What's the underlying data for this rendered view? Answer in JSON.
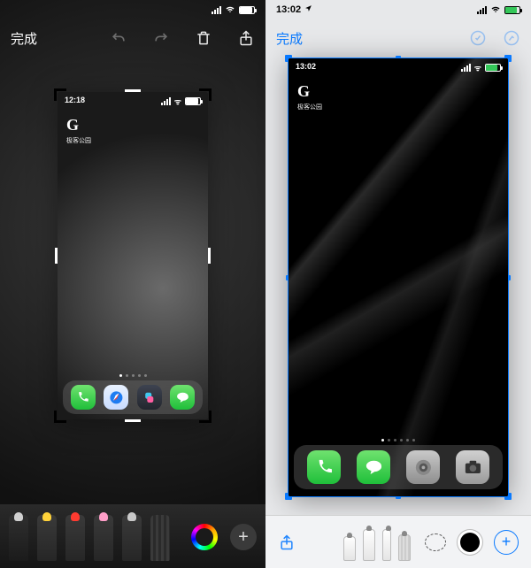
{
  "left": {
    "nav": {
      "done": "完成"
    },
    "inner": {
      "time": "12:18",
      "widget_letter": "G",
      "widget_caption": "极客公园",
      "page_dots": 5,
      "page_active": 0,
      "dock": [
        "phone",
        "safari",
        "shortcuts",
        "messages"
      ]
    },
    "tools": [
      "pen",
      "marker",
      "highlighter",
      "pencil",
      "eraser",
      "ruler"
    ]
  },
  "right": {
    "status_time": "13:02",
    "nav": {
      "done": "完成"
    },
    "inner": {
      "time": "13:02",
      "widget_letter": "G",
      "widget_caption": "极客公园",
      "page_dots": 6,
      "page_active": 0,
      "dock": [
        "phone",
        "messages",
        "settings",
        "camera"
      ]
    },
    "bottom_tools": [
      "share",
      "pen-thin",
      "pen-medium",
      "pen-fine",
      "pen-chisel",
      "lasso",
      "ink",
      "add"
    ]
  }
}
